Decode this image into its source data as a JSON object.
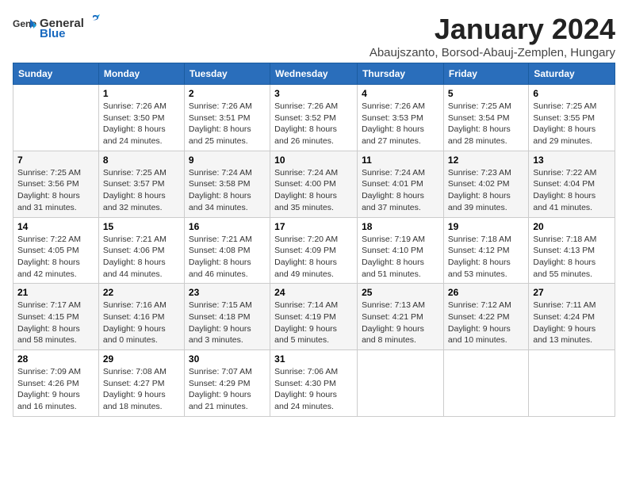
{
  "logo": {
    "general": "General",
    "blue": "Blue"
  },
  "title": "January 2024",
  "location": "Abaujszanto, Borsod-Abauj-Zemplen, Hungary",
  "weekdays": [
    "Sunday",
    "Monday",
    "Tuesday",
    "Wednesday",
    "Thursday",
    "Friday",
    "Saturday"
  ],
  "weeks": [
    [
      {
        "day": "",
        "info": ""
      },
      {
        "day": "1",
        "info": "Sunrise: 7:26 AM\nSunset: 3:50 PM\nDaylight: 8 hours\nand 24 minutes."
      },
      {
        "day": "2",
        "info": "Sunrise: 7:26 AM\nSunset: 3:51 PM\nDaylight: 8 hours\nand 25 minutes."
      },
      {
        "day": "3",
        "info": "Sunrise: 7:26 AM\nSunset: 3:52 PM\nDaylight: 8 hours\nand 26 minutes."
      },
      {
        "day": "4",
        "info": "Sunrise: 7:26 AM\nSunset: 3:53 PM\nDaylight: 8 hours\nand 27 minutes."
      },
      {
        "day": "5",
        "info": "Sunrise: 7:25 AM\nSunset: 3:54 PM\nDaylight: 8 hours\nand 28 minutes."
      },
      {
        "day": "6",
        "info": "Sunrise: 7:25 AM\nSunset: 3:55 PM\nDaylight: 8 hours\nand 29 minutes."
      }
    ],
    [
      {
        "day": "7",
        "info": "Sunrise: 7:25 AM\nSunset: 3:56 PM\nDaylight: 8 hours\nand 31 minutes."
      },
      {
        "day": "8",
        "info": "Sunrise: 7:25 AM\nSunset: 3:57 PM\nDaylight: 8 hours\nand 32 minutes."
      },
      {
        "day": "9",
        "info": "Sunrise: 7:24 AM\nSunset: 3:58 PM\nDaylight: 8 hours\nand 34 minutes."
      },
      {
        "day": "10",
        "info": "Sunrise: 7:24 AM\nSunset: 4:00 PM\nDaylight: 8 hours\nand 35 minutes."
      },
      {
        "day": "11",
        "info": "Sunrise: 7:24 AM\nSunset: 4:01 PM\nDaylight: 8 hours\nand 37 minutes."
      },
      {
        "day": "12",
        "info": "Sunrise: 7:23 AM\nSunset: 4:02 PM\nDaylight: 8 hours\nand 39 minutes."
      },
      {
        "day": "13",
        "info": "Sunrise: 7:22 AM\nSunset: 4:04 PM\nDaylight: 8 hours\nand 41 minutes."
      }
    ],
    [
      {
        "day": "14",
        "info": "Sunrise: 7:22 AM\nSunset: 4:05 PM\nDaylight: 8 hours\nand 42 minutes."
      },
      {
        "day": "15",
        "info": "Sunrise: 7:21 AM\nSunset: 4:06 PM\nDaylight: 8 hours\nand 44 minutes."
      },
      {
        "day": "16",
        "info": "Sunrise: 7:21 AM\nSunset: 4:08 PM\nDaylight: 8 hours\nand 46 minutes."
      },
      {
        "day": "17",
        "info": "Sunrise: 7:20 AM\nSunset: 4:09 PM\nDaylight: 8 hours\nand 49 minutes."
      },
      {
        "day": "18",
        "info": "Sunrise: 7:19 AM\nSunset: 4:10 PM\nDaylight: 8 hours\nand 51 minutes."
      },
      {
        "day": "19",
        "info": "Sunrise: 7:18 AM\nSunset: 4:12 PM\nDaylight: 8 hours\nand 53 minutes."
      },
      {
        "day": "20",
        "info": "Sunrise: 7:18 AM\nSunset: 4:13 PM\nDaylight: 8 hours\nand 55 minutes."
      }
    ],
    [
      {
        "day": "21",
        "info": "Sunrise: 7:17 AM\nSunset: 4:15 PM\nDaylight: 8 hours\nand 58 minutes."
      },
      {
        "day": "22",
        "info": "Sunrise: 7:16 AM\nSunset: 4:16 PM\nDaylight: 9 hours\nand 0 minutes."
      },
      {
        "day": "23",
        "info": "Sunrise: 7:15 AM\nSunset: 4:18 PM\nDaylight: 9 hours\nand 3 minutes."
      },
      {
        "day": "24",
        "info": "Sunrise: 7:14 AM\nSunset: 4:19 PM\nDaylight: 9 hours\nand 5 minutes."
      },
      {
        "day": "25",
        "info": "Sunrise: 7:13 AM\nSunset: 4:21 PM\nDaylight: 9 hours\nand 8 minutes."
      },
      {
        "day": "26",
        "info": "Sunrise: 7:12 AM\nSunset: 4:22 PM\nDaylight: 9 hours\nand 10 minutes."
      },
      {
        "day": "27",
        "info": "Sunrise: 7:11 AM\nSunset: 4:24 PM\nDaylight: 9 hours\nand 13 minutes."
      }
    ],
    [
      {
        "day": "28",
        "info": "Sunrise: 7:09 AM\nSunset: 4:26 PM\nDaylight: 9 hours\nand 16 minutes."
      },
      {
        "day": "29",
        "info": "Sunrise: 7:08 AM\nSunset: 4:27 PM\nDaylight: 9 hours\nand 18 minutes."
      },
      {
        "day": "30",
        "info": "Sunrise: 7:07 AM\nSunset: 4:29 PM\nDaylight: 9 hours\nand 21 minutes."
      },
      {
        "day": "31",
        "info": "Sunrise: 7:06 AM\nSunset: 4:30 PM\nDaylight: 9 hours\nand 24 minutes."
      },
      {
        "day": "",
        "info": ""
      },
      {
        "day": "",
        "info": ""
      },
      {
        "day": "",
        "info": ""
      }
    ]
  ]
}
